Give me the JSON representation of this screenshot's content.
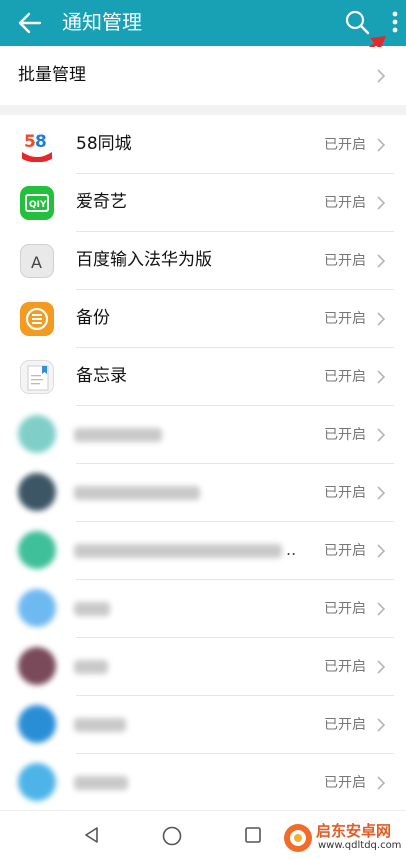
{
  "header": {
    "title": "通知管理",
    "back_icon": "arrow-left-icon",
    "search_icon": "search-icon",
    "more_icon": "more-vertical-icon",
    "bg_color": "#18a1b5"
  },
  "batch": {
    "label": "批量管理"
  },
  "apps": [
    {
      "name": "58同城",
      "status": "已开启",
      "icon": "58-tongcheng-app-icon"
    },
    {
      "name": "爱奇艺",
      "status": "已开启",
      "icon": "iqiyi-app-icon"
    },
    {
      "name": "百度输入法华为版",
      "status": "已开启",
      "icon": "baidu-input-app-icon"
    },
    {
      "name": "备份",
      "status": "已开启",
      "icon": "backup-app-icon"
    },
    {
      "name": "备忘录",
      "status": "已开启",
      "icon": "notes-app-icon"
    },
    {
      "name": "",
      "status": "已开启",
      "icon": "blurred-app-icon"
    },
    {
      "name": "",
      "status": "已开启",
      "icon": "blurred-app-icon"
    },
    {
      "name": "",
      "status": "已开启",
      "icon": "blurred-app-icon"
    },
    {
      "name": "",
      "status": "已开启",
      "icon": "blurred-app-icon"
    },
    {
      "name": "",
      "status": "已开启",
      "icon": "blurred-app-icon"
    },
    {
      "name": "",
      "status": "已开启",
      "icon": "blurred-app-icon"
    },
    {
      "name": "",
      "status": "已开启",
      "icon": "blurred-app-icon"
    }
  ],
  "navbar": {
    "back_icon": "nav-back-triangle-icon",
    "home_icon": "nav-home-circle-icon",
    "recent_icon": "nav-recent-square-icon"
  },
  "watermark": {
    "title": "启东安卓网",
    "url": "www.qdltdq.com"
  }
}
